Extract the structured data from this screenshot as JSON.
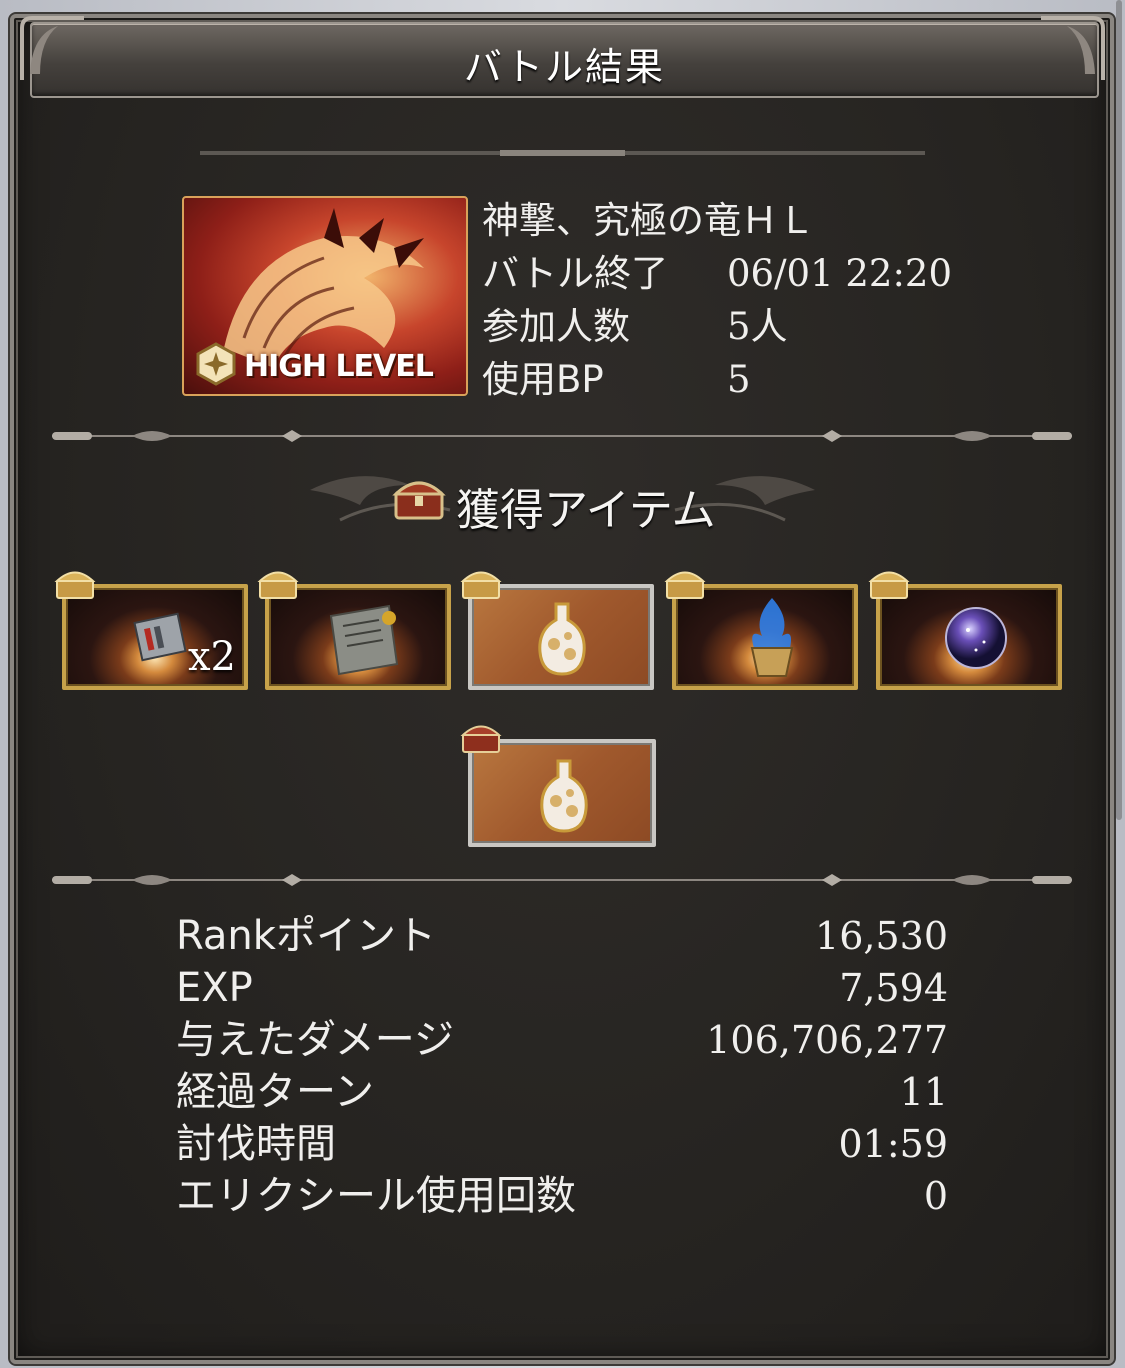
{
  "header": {
    "title": "バトル結果"
  },
  "boss": {
    "badge": "HIGH LEVEL",
    "info": [
      {
        "label": "神撃、究極の竜ＨＬ",
        "value": ""
      },
      {
        "label": "バトル終了",
        "value": "06/01 22:20"
      },
      {
        "label": "参加人数",
        "value": "5人"
      },
      {
        "label": "使用BP",
        "value": "5"
      }
    ]
  },
  "items": {
    "heading": "獲得アイテム",
    "list": [
      {
        "name": "steel-card-icon",
        "qty": "x2",
        "frame": "gold",
        "chest": "gold"
      },
      {
        "name": "scroll-icon",
        "qty": "",
        "frame": "gold",
        "chest": "gold"
      },
      {
        "name": "potion-bottle-icon",
        "qty": "",
        "frame": "silver",
        "chest": "gold"
      },
      {
        "name": "blue-flame-urn-icon",
        "qty": "",
        "frame": "gold",
        "chest": "gold"
      },
      {
        "name": "galaxy-orb-icon",
        "qty": "",
        "frame": "gold",
        "chest": "gold"
      },
      {
        "name": "potion-bottle-icon",
        "qty": "",
        "frame": "silver",
        "chest": "red"
      }
    ]
  },
  "stats": [
    {
      "label": "Rankポイント",
      "value": "16,530"
    },
    {
      "label": "EXP",
      "value": "7,594"
    },
    {
      "label": "与えたダメージ",
      "value": "106,706,277"
    },
    {
      "label": "経過ターン",
      "value": "11"
    },
    {
      "label": "討伐時間",
      "value": "01:59"
    },
    {
      "label": "エリクシール使用回数",
      "value": "0"
    }
  ],
  "colors": {
    "panel": "#262421",
    "gold": "#c7a24a",
    "text": "#f0efed"
  }
}
